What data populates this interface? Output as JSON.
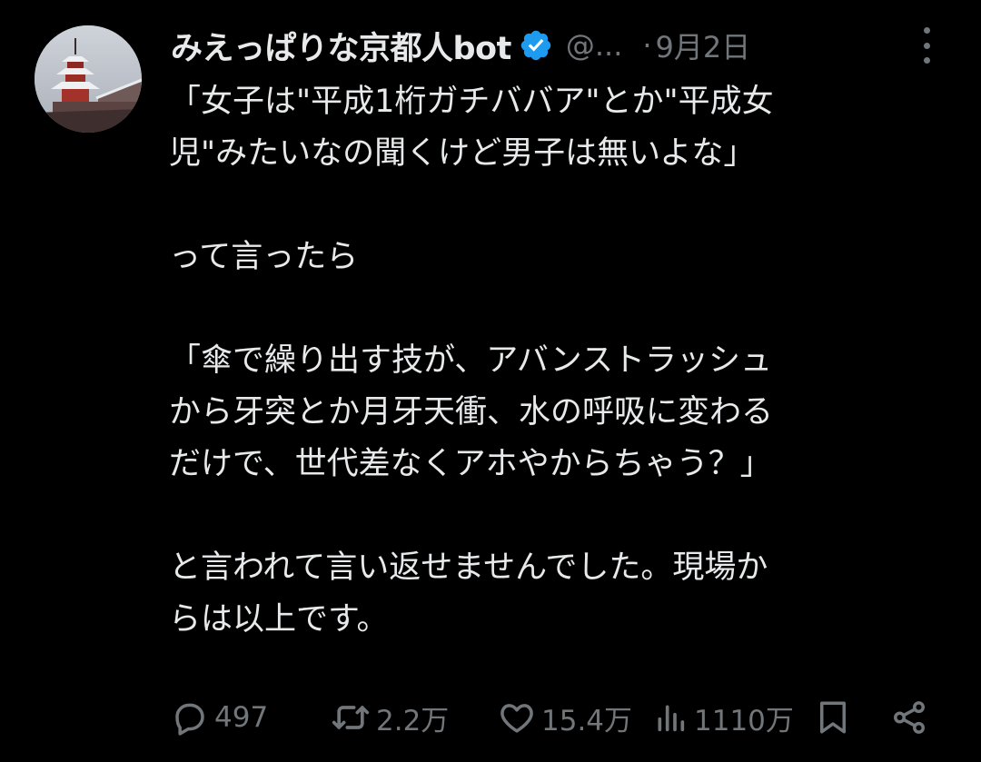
{
  "tweet": {
    "author": {
      "display_name": "みえっぱりな京都人bot",
      "handle": "@...",
      "verified": true
    },
    "separator": "·",
    "date": "9月2日",
    "text": "「女子は\"平成1桁ガチババア\"とか\"平成女\n児\"みたいなの聞くけど男子は無いよな」\n\nって言ったら\n\n「傘で繰り出す技が、アバンストラッシュ\nから牙突とか月牙天衝、水の呼吸に変わる\nだけで、世代差なくアホやからちゃう？」\n\nと言われて言い返せませんでした。現場か\nらは以上です。",
    "metrics": {
      "replies": "497",
      "reposts": "2.2万",
      "likes": "15.4万",
      "views": "1110万"
    }
  },
  "icons": {
    "verified": "verified-badge-icon",
    "more": "more-options-icon",
    "reply": "reply-icon",
    "repost": "repost-icon",
    "like": "like-icon",
    "views": "views-icon",
    "bookmark": "bookmark-icon",
    "share": "share-icon"
  },
  "colors": {
    "background": "#000000",
    "text": "#e7e9ea",
    "muted": "#71767b",
    "verified": "#1d9bf0"
  }
}
